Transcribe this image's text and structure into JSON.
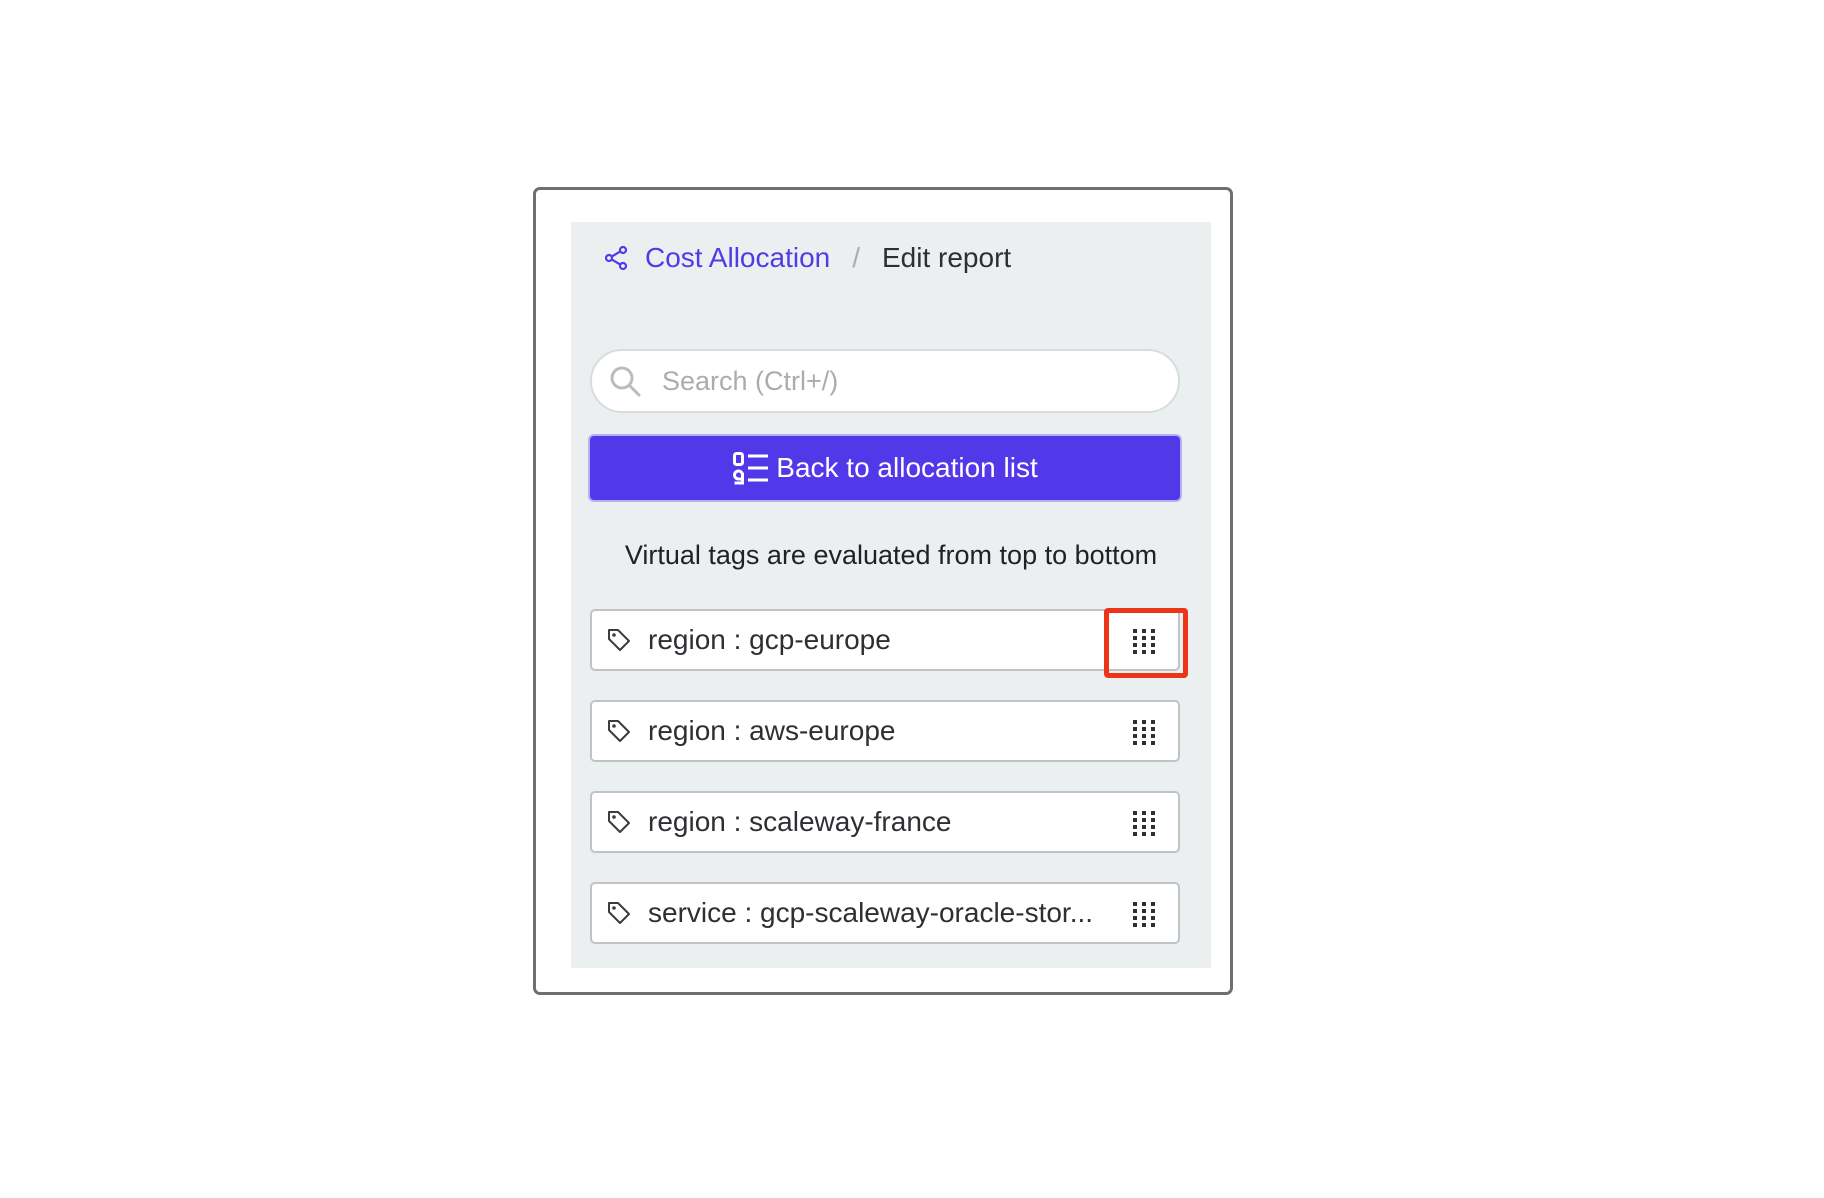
{
  "breadcrumb": {
    "parent_label": "Cost Allocation",
    "separator": "/",
    "current_label": "Edit report"
  },
  "search": {
    "placeholder": "Search (Ctrl+/)",
    "value": ""
  },
  "actions": {
    "back_label": "Back to allocation list"
  },
  "hint": "Virtual tags are evaluated from top to bottom",
  "virtual_tags": [
    {
      "label": "region : gcp-europe"
    },
    {
      "label": "region : aws-europe"
    },
    {
      "label": "region : scaleway-france"
    },
    {
      "label": "service : gcp-scaleway-oracle-stor..."
    }
  ],
  "colors": {
    "accent": "#5338ea",
    "link": "#4f3be8",
    "panel_bg": "#eceff0",
    "highlight": "#ec3418"
  },
  "icons": {
    "breadcrumb": "share-icon",
    "search": "search-icon",
    "back_button": "list-numbered-icon",
    "tag": "tag-icon",
    "drag": "drag-handle-icon"
  }
}
